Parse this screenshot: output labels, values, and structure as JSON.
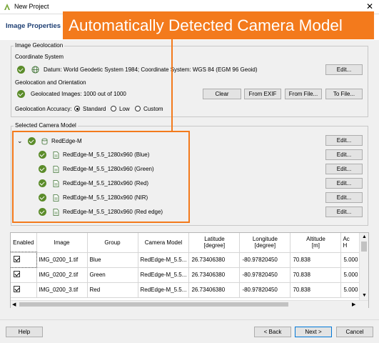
{
  "window": {
    "title": "New Project",
    "close_glyph": "✕"
  },
  "header": {
    "title": "Image Properties"
  },
  "callout": {
    "text": "Automatically Detected Camera Model",
    "color": "#f37a1c"
  },
  "geolocation": {
    "legend": "Image Geolocation",
    "coord_system_label": "Coordinate System",
    "datum_text": "Datum: World Geodetic System 1984; Coordinate System: WGS 84 (EGM 96 Geoid)",
    "edit_label": "Edit...",
    "geo_orient_label": "Geolocation and Orientation",
    "geolocated_text": "Geolocated Images: 1000 out of 1000",
    "clear_label": "Clear",
    "from_exif_label": "From EXIF",
    "from_file_label": "From File...",
    "to_file_label": "To File...",
    "accuracy_label": "Geolocation Accuracy:",
    "accuracy_options": [
      "Standard",
      "Low",
      "Custom"
    ],
    "accuracy_selected": "Standard"
  },
  "camera": {
    "legend": "Selected Camera Model",
    "model_name": "RedEdge-M",
    "bands": [
      "RedEdge-M_5.5_1280x960 (Blue)",
      "RedEdge-M_5.5_1280x960 (Green)",
      "RedEdge-M_5.5_1280x960 (Red)",
      "RedEdge-M_5.5_1280x960 (NIR)",
      "RedEdge-M_5.5_1280x960 (Red edge)"
    ],
    "edit_label": "Edit..."
  },
  "table": {
    "headers": {
      "enabled": "Enabled",
      "image": "Image",
      "group": "Group",
      "camera_model": "Camera Model",
      "latitude": "Latitude",
      "latitude_unit": "[degree]",
      "longitude": "Longitude",
      "longitude_unit": "[degree]",
      "altitude": "Altitude",
      "altitude_unit": "[m]",
      "accuracy_h": "Ac",
      "accuracy_h2": "H"
    },
    "rows": [
      {
        "enabled": true,
        "image": "IMG_0200_1.tif",
        "group": "Blue",
        "camera_model": "RedEdge-M_5.5...",
        "latitude": "26.73406380",
        "longitude": "-80.97820450",
        "altitude": "70.838",
        "accuracy": "5.000"
      },
      {
        "enabled": true,
        "image": "IMG_0200_2.tif",
        "group": "Green",
        "camera_model": "RedEdge-M_5.5...",
        "latitude": "26.73406380",
        "longitude": "-80.97820450",
        "altitude": "70.838",
        "accuracy": "5.000"
      },
      {
        "enabled": true,
        "image": "IMG_0200_3.tif",
        "group": "Red",
        "camera_model": "RedEdge-M_5.5...",
        "latitude": "26.73406380",
        "longitude": "-80.97820450",
        "altitude": "70.838",
        "accuracy": "5.000"
      }
    ]
  },
  "footer": {
    "help_label": "Help",
    "back_label": "< Back",
    "next_label": "Next >",
    "cancel_label": "Cancel"
  }
}
